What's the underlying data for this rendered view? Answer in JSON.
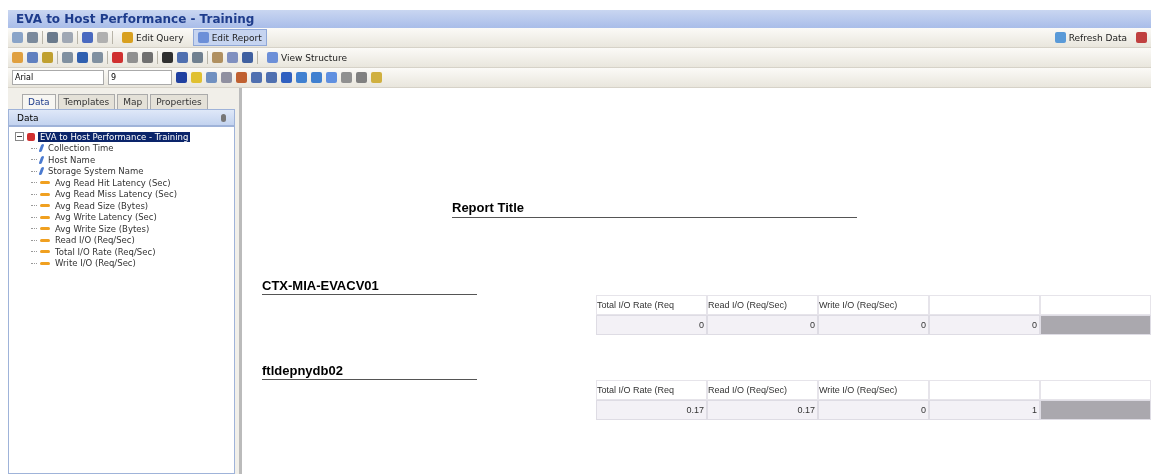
{
  "window": {
    "title": "EVA to Host Performance - Training"
  },
  "toolbar": {
    "buttons": [
      {
        "label": "Edit Query",
        "selected": false
      },
      {
        "label": "Edit Report",
        "selected": true
      }
    ],
    "refresh": "Refresh Data"
  },
  "toolbar_2": {
    "view_structure": "View Structure"
  },
  "format_bar": {
    "font": "Arial",
    "size": "9"
  },
  "side_tabs": [
    {
      "label": "Data",
      "selected": true
    },
    {
      "label": "Templates",
      "selected": false
    },
    {
      "label": "Map",
      "selected": false
    },
    {
      "label": "Properties",
      "selected": false
    }
  ],
  "panel": {
    "title": "Data"
  },
  "tree": {
    "label": "EVA to Host Performance - Training",
    "expanded": true,
    "selected": true,
    "children": [
      {
        "label": "Collection Time",
        "kind": "dimension"
      },
      {
        "label": "Host Name",
        "kind": "dimension"
      },
      {
        "label": "Storage System Name",
        "kind": "dimension"
      },
      {
        "label": "Avg Read Hit Latency (Sec)",
        "kind": "measure"
      },
      {
        "label": "Avg Read Miss Latency (Sec)",
        "kind": "measure"
      },
      {
        "label": "Avg Read Size (Bytes)",
        "kind": "measure"
      },
      {
        "label": "Avg Write Latency (Sec)",
        "kind": "measure"
      },
      {
        "label": "Avg Write Size (Bytes)",
        "kind": "measure"
      },
      {
        "label": "Read I/O (Req/Sec)",
        "kind": "measure"
      },
      {
        "label": "Total I/O Rate (Req/Sec)",
        "kind": "measure"
      },
      {
        "label": "Write I/O (Req/Sec)",
        "kind": "measure"
      }
    ]
  },
  "report": {
    "title": "Report Title",
    "sections": [
      {
        "heading": "CTX-MIA-EVACV01",
        "columns": [
          "Total I/O Rate (Req",
          "Read I/O (Req/Sec)",
          "Write I/O (Req/Sec)"
        ],
        "values": [
          "0",
          "0",
          "0",
          "0"
        ]
      },
      {
        "heading": "ftldepnydb02",
        "columns": [
          "Total I/O Rate (Req",
          "Read I/O (Req/Sec)",
          "Write I/O (Req/Sec)"
        ],
        "values": [
          "0.17",
          "0.17",
          "0",
          "1"
        ]
      }
    ]
  }
}
